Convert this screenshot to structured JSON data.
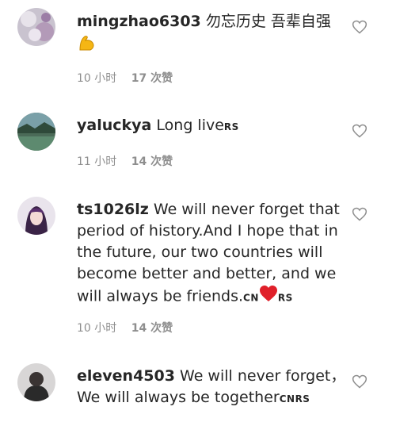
{
  "comments": [
    {
      "username": "mingzhao6303",
      "text": "勿忘历史 吾辈自强",
      "emoji": "flexed-biceps",
      "time": "10 小时",
      "likes": "17 次赞"
    },
    {
      "username": "yaluckya",
      "text": "Long live",
      "flag_suffix": "RS",
      "time": "11 小时",
      "likes": "14 次赞"
    },
    {
      "username": "ts1026lz",
      "text": "We will never forget that period of history.And I hope that in the future, our two countries will become better and better, and we will always be friends.",
      "flag_cn": "CN",
      "flag_rs": "RS",
      "time": "10 小时",
      "likes": "14 次赞"
    },
    {
      "username": "eleven4503",
      "text": "We will never forget，We will always be together",
      "flag_suffix": "CNRS"
    }
  ],
  "icons": {
    "like": "heart-outline-icon",
    "emoji_heart": "red-heart"
  },
  "colors": {
    "meta": "#8e8e8e",
    "heart_outline": "#8e8e8e",
    "red_heart": "#e0202a"
  }
}
